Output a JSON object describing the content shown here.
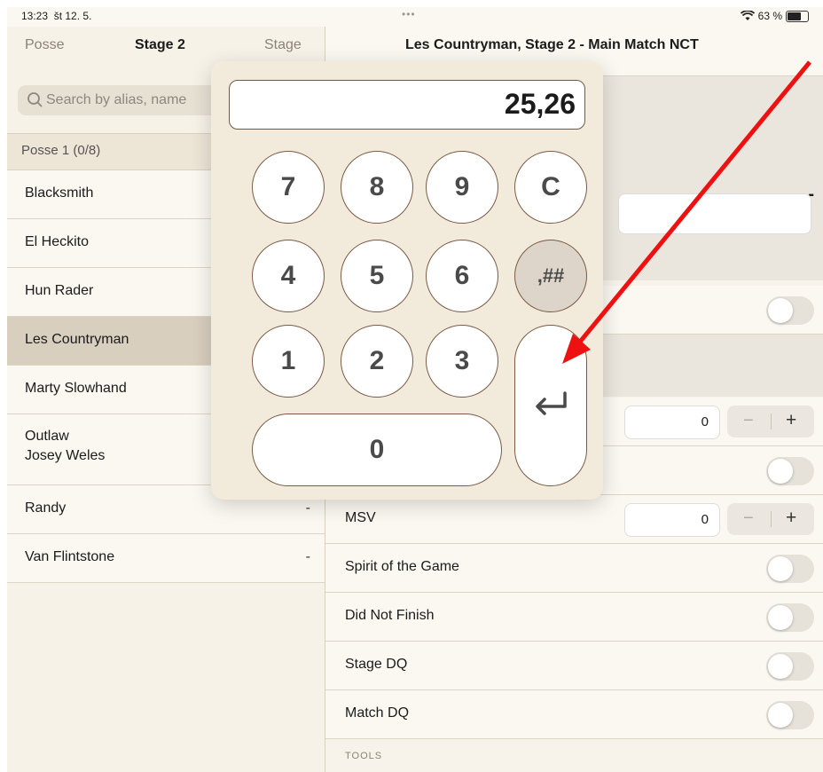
{
  "status": {
    "time": "13:23",
    "date": "št 12. 5.",
    "dots": "•••",
    "battery": "63 %"
  },
  "sidebar": {
    "tab_left": "Posse",
    "title": "Stage 2",
    "tab_right": "Stage",
    "search_placeholder": "Search by alias, name",
    "section": "Posse 1 (0/8)",
    "items": [
      {
        "name": "Blacksmith",
        "value": ""
      },
      {
        "name": "El Heckito",
        "value": ""
      },
      {
        "name": "Hun Rader",
        "value": ""
      },
      {
        "name": "Les Countryman",
        "value": ""
      },
      {
        "name": "Marty Slowhand",
        "value": ""
      },
      {
        "name": "Outlaw\nJosey Weles",
        "value": ""
      },
      {
        "name": "Randy",
        "value": "-"
      },
      {
        "name": "Van Flintstone",
        "value": "-"
      }
    ]
  },
  "detail": {
    "title": "Les Countryman, Stage 2 - Main Match NCT",
    "dash": "-",
    "rows": {
      "msv_label": "MSV",
      "msv_value": "0",
      "counter1_value": "0",
      "spirit_label": "Spirit of the Game",
      "dnf_label": "Did Not Finish",
      "stage_dq_label": "Stage DQ",
      "match_dq_label": "Match DQ"
    },
    "stepper": {
      "minus": "−",
      "plus": "+"
    },
    "tools_label": "TOOLS"
  },
  "keypad": {
    "display": "25,26",
    "keys": {
      "k7": "7",
      "k8": "8",
      "k9": "9",
      "clear": "C",
      "k4": "4",
      "k5": "5",
      "k6": "6",
      "decimal": ",##",
      "k1": "1",
      "k2": "2",
      "k3": "3",
      "k0": "0",
      "enter": "↵"
    }
  },
  "colors": {
    "annotation_arrow": "#ee1111",
    "selected_row": "#d8cfbe"
  }
}
